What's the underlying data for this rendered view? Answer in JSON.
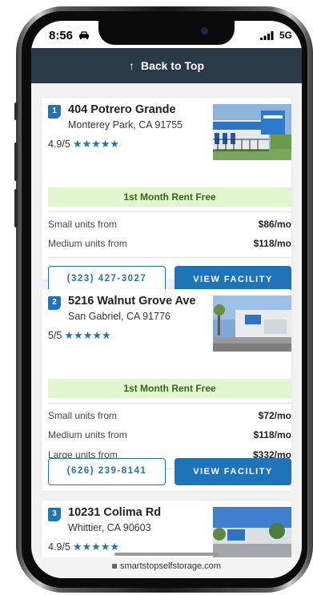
{
  "status": {
    "time": "8:56",
    "network": "5G"
  },
  "back_to_top": {
    "label": "Back to Top"
  },
  "facilities": [
    {
      "number": "1",
      "address": "404 Potrero Grande",
      "city": "Monterey Park, CA 91755",
      "rating": "4.9/5",
      "stars": "★★★★★",
      "promo": "1st Month Rent Free",
      "prices": [
        {
          "label": "Small units from",
          "value": "$86/mo"
        },
        {
          "label": "Medium units from",
          "value": "$118/mo"
        }
      ],
      "phone": "(323) 427-3027",
      "view_label": "VIEW FACILITY"
    },
    {
      "number": "2",
      "address": "5216 Walnut Grove Ave",
      "city": "San Gabriel, CA 91776",
      "rating": "5/5",
      "stars": "★★★★★",
      "promo": "1st Month Rent Free",
      "prices": [
        {
          "label": "Small units from",
          "value": "$72/mo"
        },
        {
          "label": "Medium units from",
          "value": "$118/mo"
        },
        {
          "label": "Large units from",
          "value": "$332/mo"
        }
      ],
      "phone": "(626) 239-8141",
      "view_label": "VIEW FACILITY"
    },
    {
      "number": "3",
      "address": "10231 Colima Rd",
      "city": "Whittier, CA 90603",
      "rating": "4.9/5",
      "stars": "★★★★★"
    }
  ],
  "browser": {
    "url": "smartstopselfstorage.com"
  },
  "colors": {
    "accent": "#1f73b7",
    "header": "#2b3a47",
    "promo_bg": "#e2f7d0",
    "promo_text": "#2f6a13"
  }
}
